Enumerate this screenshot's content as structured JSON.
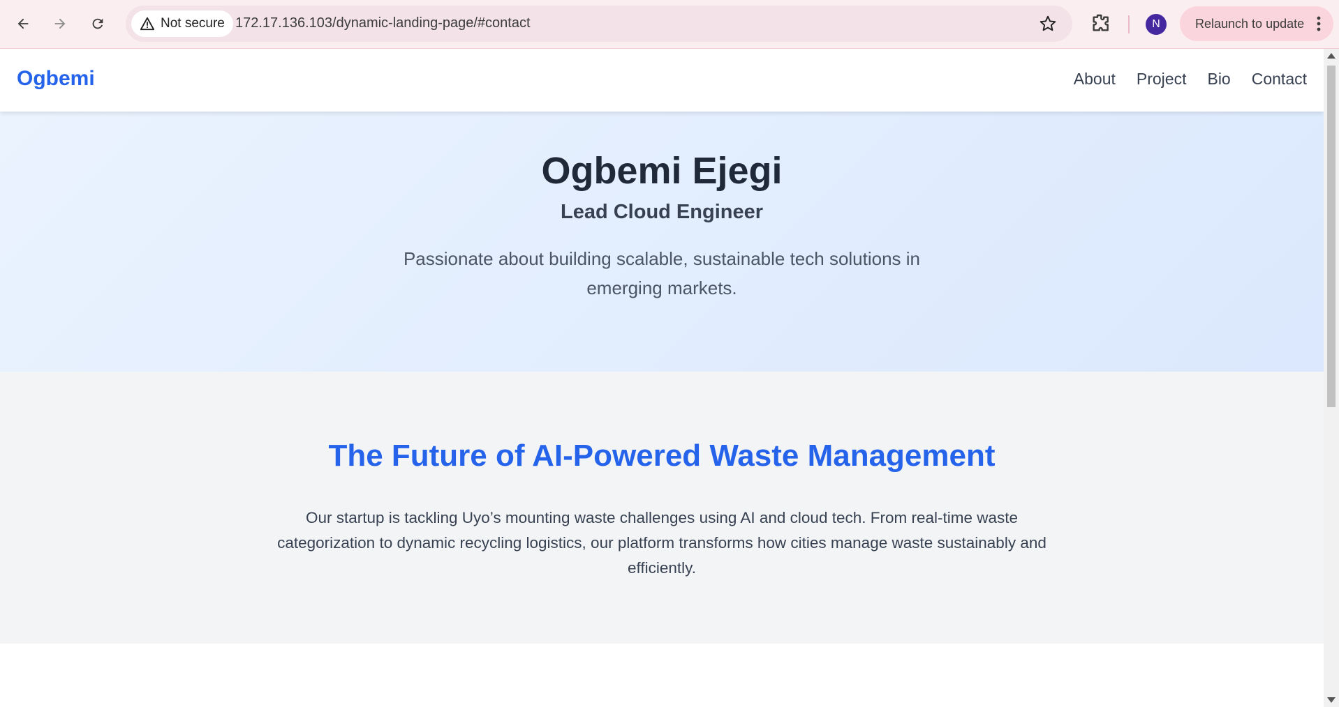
{
  "browser": {
    "security_label": "Not secure",
    "url": "172.17.136.103/dynamic-landing-page/#contact",
    "profile_initial": "N",
    "relaunch_label": "Relaunch to update"
  },
  "site": {
    "logo": "Ogbemi",
    "nav": [
      {
        "label": "About"
      },
      {
        "label": "Project"
      },
      {
        "label": "Bio"
      },
      {
        "label": "Contact"
      }
    ]
  },
  "hero": {
    "name": "Ogbemi Ejegi",
    "title": "Lead Cloud Engineer",
    "description": "Passionate about building scalable, sustainable tech solutions in emerging markets."
  },
  "project": {
    "title": "The Future of AI-Powered Waste Management",
    "description": "Our startup is tackling Uyo’s mounting waste challenges using AI and cloud tech. From real-time waste categorization to dynamic recycling logistics, our platform transforms how cities manage waste sustainably and efficiently."
  },
  "colors": {
    "accent": "#2563eb",
    "chrome_bg": "#fbeef1",
    "profile_bg": "#4527a0"
  }
}
